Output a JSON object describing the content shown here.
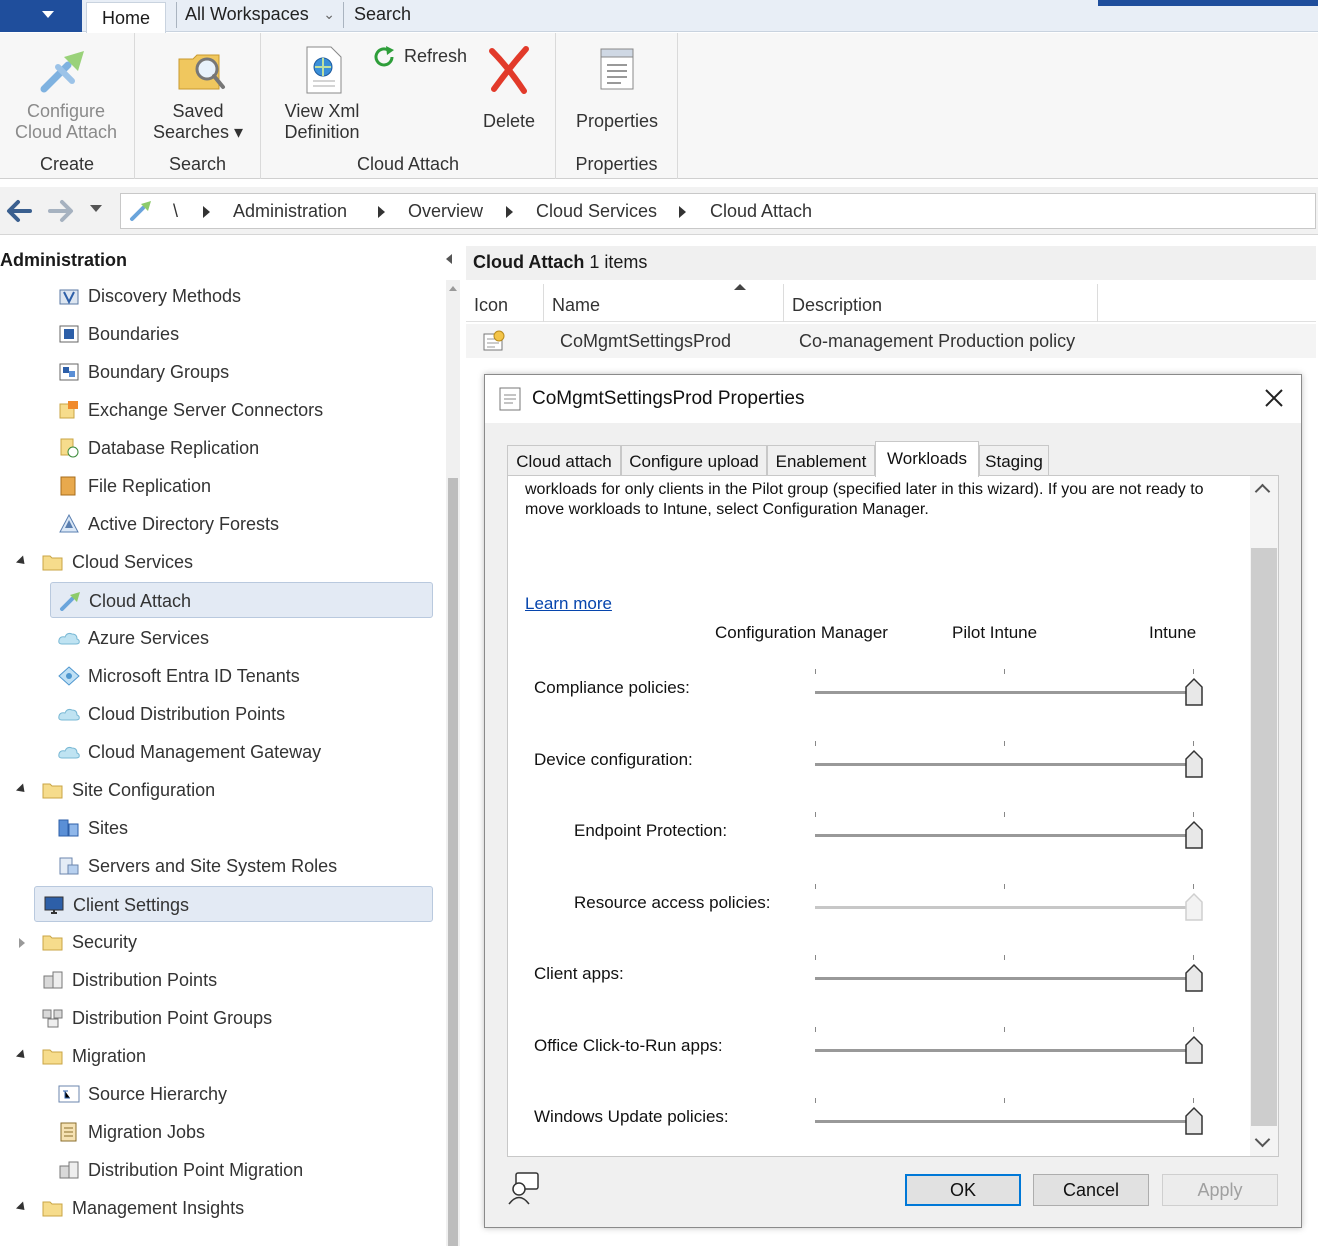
{
  "tabstrip": {
    "home_tab": "Home",
    "workspace_select": "All Workspaces",
    "search": "Search"
  },
  "ribbon": {
    "groups": [
      {
        "label": "Create",
        "buttons": [
          {
            "line1": "Configure",
            "line2": "Cloud Attach",
            "enabled": false
          }
        ]
      },
      {
        "label": "Search",
        "buttons": [
          {
            "line1": "Saved",
            "line2": "Searches ▾",
            "enabled": true
          }
        ]
      },
      {
        "label": "Cloud Attach",
        "buttons": [
          {
            "line1": "View Xml",
            "line2": "Definition",
            "enabled": true
          },
          {
            "line1": "Refresh",
            "line2": "",
            "enabled": true
          },
          {
            "line1": "Delete",
            "line2": "",
            "enabled": true
          }
        ]
      },
      {
        "label": "Properties",
        "buttons": [
          {
            "line1": "Properties",
            "line2": "",
            "enabled": true
          }
        ]
      }
    ]
  },
  "breadcrumb": {
    "root": "\\",
    "items": [
      "Administration",
      "Overview",
      "Cloud Services",
      "Cloud Attach"
    ]
  },
  "tree": {
    "title": "Administration",
    "items": [
      {
        "label": "Discovery Methods",
        "icon": "discovery-icon"
      },
      {
        "label": "Boundaries",
        "icon": "boundary-icon"
      },
      {
        "label": "Boundary Groups",
        "icon": "boundary-group-icon"
      },
      {
        "label": "Exchange Server Connectors",
        "icon": "exchange-icon"
      },
      {
        "label": "Database Replication",
        "icon": "database-icon"
      },
      {
        "label": "File Replication",
        "icon": "file-replication-icon"
      },
      {
        "label": "Active Directory Forests",
        "icon": "ad-forest-icon"
      },
      {
        "label": "Cloud Services",
        "icon": "folder-icon"
      },
      {
        "label": "Cloud Attach",
        "icon": "cloud-attach-icon"
      },
      {
        "label": "Azure Services",
        "icon": "cloud-icon"
      },
      {
        "label": "Microsoft Entra ID Tenants",
        "icon": "entra-icon"
      },
      {
        "label": "Cloud Distribution Points",
        "icon": "cloud-icon"
      },
      {
        "label": "Cloud Management Gateway",
        "icon": "cloud-icon"
      },
      {
        "label": "Site Configuration",
        "icon": "folder-icon"
      },
      {
        "label": "Sites",
        "icon": "sites-icon"
      },
      {
        "label": "Servers and Site System Roles",
        "icon": "server-icon"
      },
      {
        "label": "Client Settings",
        "icon": "monitor-icon"
      },
      {
        "label": "Security",
        "icon": "folder-icon"
      },
      {
        "label": "Distribution Points",
        "icon": "dp-icon"
      },
      {
        "label": "Distribution Point Groups",
        "icon": "dp-group-icon"
      },
      {
        "label": "Migration",
        "icon": "folder-icon"
      },
      {
        "label": "Source Hierarchy",
        "icon": "hierarchy-icon"
      },
      {
        "label": "Migration Jobs",
        "icon": "jobs-icon"
      },
      {
        "label": "Distribution Point Migration",
        "icon": "dp-icon"
      },
      {
        "label": "Management Insights",
        "icon": "folder-icon"
      }
    ]
  },
  "list": {
    "title": "Cloud Attach",
    "count": "1 items",
    "columns": [
      "Icon",
      "Name",
      "Description"
    ],
    "rows": [
      {
        "name": "CoMgmtSettingsProd",
        "description": "Co-management Production policy"
      }
    ]
  },
  "dialog": {
    "title": "CoMgmtSettingsProd Properties",
    "tabs": [
      "Cloud attach",
      "Configure upload",
      "Enablement",
      "Workloads",
      "Staging"
    ],
    "active_tab": "Workloads",
    "intro_text": "workloads for only clients in the Pilot group (specified later in this wizard). If you are not ready to move workloads to Intune, select Configuration Manager.",
    "learn_more": "Learn more",
    "slider_columns": [
      "Configuration Manager",
      "Pilot Intune",
      "Intune"
    ],
    "workloads": [
      {
        "label": "Compliance policies:",
        "value": "Intune",
        "enabled": true
      },
      {
        "label": "Device configuration:",
        "value": "Intune",
        "enabled": true
      },
      {
        "label": "Endpoint Protection:",
        "value": "Intune",
        "enabled": true
      },
      {
        "label": "Resource access policies:",
        "value": "Intune",
        "enabled": false
      },
      {
        "label": "Client apps:",
        "value": "Intune",
        "enabled": true
      },
      {
        "label": "Office Click-to-Run apps:",
        "value": "Intune",
        "enabled": true
      },
      {
        "label": "Windows Update policies:",
        "value": "Intune",
        "enabled": true
      }
    ],
    "buttons": {
      "ok": "OK",
      "cancel": "Cancel",
      "apply": "Apply"
    }
  },
  "colors": {
    "accent": "#1f4e9c",
    "link": "#0645ad",
    "selection": "#e3eaf4",
    "focus_border": "#0078d7"
  }
}
